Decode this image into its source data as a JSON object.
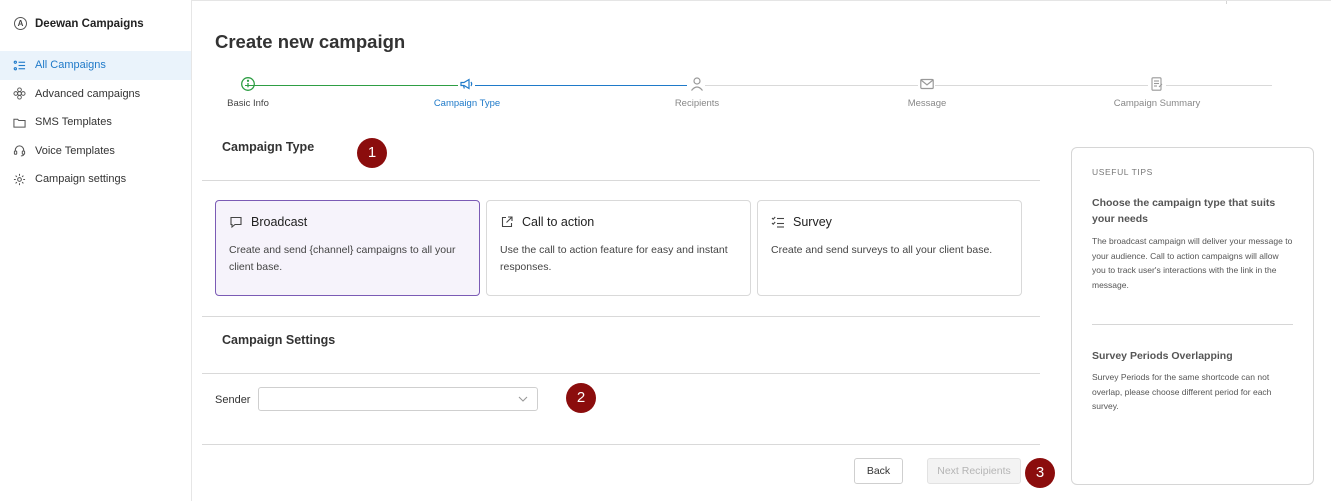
{
  "sidebar": {
    "brand": "Deewan Campaigns",
    "brand_logo": "A",
    "items": [
      {
        "label": "All Campaigns",
        "icon": "list-icon",
        "active": true
      },
      {
        "label": "Advanced campaigns",
        "icon": "gear-flower-icon"
      },
      {
        "label": "SMS Templates",
        "icon": "folder-icon"
      },
      {
        "label": "Voice Templates",
        "icon": "headset-icon"
      },
      {
        "label": "Campaign settings",
        "icon": "settings-icon"
      }
    ]
  },
  "page": {
    "title": "Create new campaign"
  },
  "stepper": {
    "steps": [
      {
        "label": "Basic Info",
        "state": "done",
        "icon": "info-check-icon"
      },
      {
        "label": "Campaign Type",
        "state": "current",
        "icon": "megaphone-icon"
      },
      {
        "label": "Recipients",
        "state": "pending",
        "icon": "person-icon"
      },
      {
        "label": "Message",
        "state": "pending",
        "icon": "envelope-icon"
      },
      {
        "label": "Campaign Summary",
        "state": "pending",
        "icon": "document-icon"
      }
    ]
  },
  "campaign_type": {
    "title": "Campaign Type",
    "cards": [
      {
        "title": "Broadcast",
        "description": "Create and send {channel} campaigns to all your client base.",
        "icon": "chat-bubble-icon",
        "selected": true
      },
      {
        "title": "Call to action",
        "description": "Use the call to action feature for easy and instant responses.",
        "icon": "external-link-icon",
        "selected": false
      },
      {
        "title": "Survey",
        "description": "Create and send surveys to all your client base.",
        "icon": "checklist-icon",
        "selected": false
      }
    ]
  },
  "campaign_settings": {
    "title": "Campaign Settings",
    "sender_label": "Sender",
    "sender_value": ""
  },
  "actions": {
    "back": "Back",
    "next": "Next Recipients"
  },
  "badges": [
    "1",
    "2",
    "3"
  ],
  "tips": {
    "header": "USEFUL TIPS",
    "items": [
      {
        "title": "Choose the campaign type that suits your needs",
        "body": "The broadcast campaign will deliver your message to your audience. Call to action campaigns will allow you to track user's interactions with the link in the message."
      },
      {
        "title": "Survey Periods Overlapping",
        "body": "Survey Periods for the same shortcode can not overlap, please choose different period for each survey."
      }
    ]
  },
  "colors": {
    "accent": "#1f7ac9",
    "done": "#2e9e44",
    "selected_border": "#7b5bb5",
    "badge": "#8b0d0d"
  }
}
